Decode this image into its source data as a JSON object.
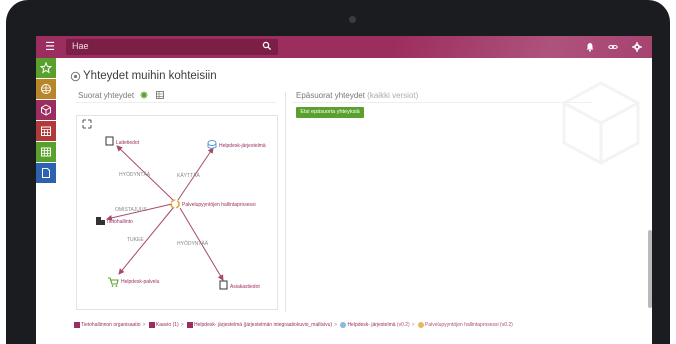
{
  "topbar": {
    "search_placeholder": "Hae",
    "icons": [
      "menu-icon",
      "search-icon",
      "bell-icon",
      "link-icon",
      "gear-icon"
    ],
    "color": "#9c2d5f"
  },
  "sidebar": {
    "items": [
      {
        "name": "star-icon",
        "color": "#5aa02c"
      },
      {
        "name": "server-icon",
        "color": "#b8852a"
      },
      {
        "name": "cube-icon",
        "color": "#9c2d5f"
      },
      {
        "name": "calendar-grid-icon",
        "color": "#b03a3a"
      },
      {
        "name": "table-icon",
        "color": "#5aa02c"
      },
      {
        "name": "document-icon",
        "color": "#2d62b0"
      }
    ]
  },
  "page": {
    "title": "Yhteydet muihin kohteisiin",
    "direct_heading": "Suorat yhteydet",
    "indirect_heading": "Epäsuorat yhteydet",
    "indirect_sub": "(kaikki versiot)",
    "indirect_button": "Etsi epäsuoria yhteyksiä"
  },
  "graph": {
    "center": "Palvelupyyntöjen hallintaprosessi",
    "nodes": [
      {
        "label": "Laitetiedot",
        "icon": "document-icon"
      },
      {
        "label": "Helpdesk-järjestelmä",
        "icon": "database-icon"
      },
      {
        "label": "Tietohallinto",
        "icon": "building-icon"
      },
      {
        "label": "Helpdesk-palvelu",
        "icon": "cart-icon"
      },
      {
        "label": "Asiakastiedot",
        "icon": "document-icon"
      }
    ],
    "edges": [
      "HYÖDYNTÄÄ",
      "KÄYTTÄÄ",
      "OMISTAJUUS",
      "TUKEE",
      "HYÖDYNTÄÄ"
    ]
  },
  "breadcrumb": {
    "items": [
      "Tietohallinnon organisaatio",
      "Kaavio (1)",
      "Helpdesk- järjestelmä (järjestelmän integraatiokuvio_mallisivu)",
      "Helpdesk- järjestelmä (v0.2)",
      "Palvelupyyntöjen hallintaprosessi (v0.2)"
    ]
  }
}
